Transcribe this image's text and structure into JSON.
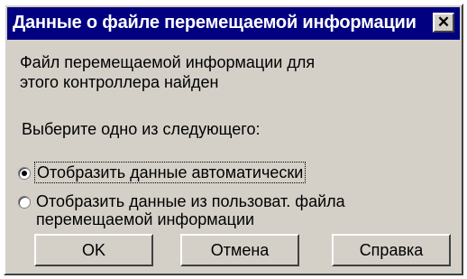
{
  "dialog": {
    "title": "Данные о файле перемещаемой информации",
    "close_label": "✕",
    "message_line1": "Файл перемещаемой информации для",
    "message_line2": "этого контроллера найден",
    "prompt": "Выберите одно из следующего:",
    "options": [
      {
        "label": "Отобразить данные автоматически",
        "selected": true
      },
      {
        "label_line1": "Отобразить данные из пользоват. файла",
        "label_line2": "перемещаемой информации",
        "selected": false
      }
    ],
    "buttons": {
      "ok": "OK",
      "cancel": "Отмена",
      "help": "Справка"
    }
  },
  "colors": {
    "titlebar": "#000080",
    "face": "#d4d0c8"
  }
}
